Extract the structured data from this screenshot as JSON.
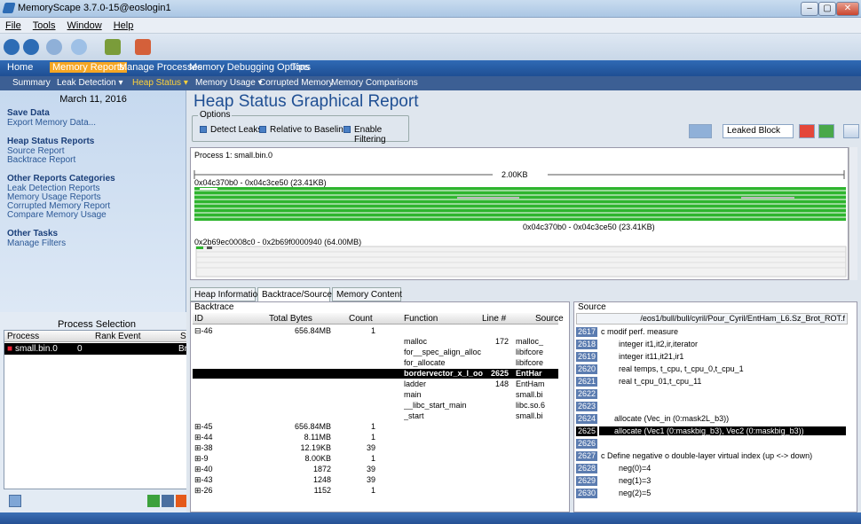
{
  "window": {
    "title": "MemoryScape 3.7.0-15@eoslogin1",
    "min": "–",
    "max": "▢",
    "close": "✕"
  },
  "menu": [
    "File",
    "Tools",
    "Window",
    "Help"
  ],
  "tabs": {
    "home": "Home",
    "memory_reports": "Memory Reports",
    "manage_processes": "Manage Processes",
    "debugging_options": "Memory Debugging Options",
    "tips": "Tips"
  },
  "subtabs": {
    "summary": "Summary",
    "leak_detection": "Leak Detection ▾",
    "heap_status": "Heap Status ▾",
    "memory_usage": "Memory Usage ▾",
    "corrupted": "Corrupted Memory",
    "comparisons": "Memory Comparisons"
  },
  "left": {
    "date": "March 11, 2016",
    "save_head": "Save Data",
    "export": "Export Memory Data...",
    "heap_head": "Heap Status Reports",
    "source_report": "Source Report",
    "backtrace_report": "Backtrace Report",
    "other_head": "Other Reports Categories",
    "leak_reports": "Leak Detection Reports",
    "usage_reports": "Memory Usage Reports",
    "corrupted_report": "Corrupted Memory Report",
    "compare_usage": "Compare Memory Usage",
    "tasks_head": "Other Tasks",
    "manage_filters": "Manage Filters"
  },
  "process_selection": {
    "title": "Process Selection",
    "headers": [
      "Process",
      "Rank",
      "Event",
      "St"
    ],
    "row": {
      "process": "small.bin.0",
      "rank": "0",
      "event": "",
      "status": "Bre"
    }
  },
  "report": {
    "title": "Heap Status Graphical Report",
    "options_label": "Options",
    "detect_leaks": "Detect Leaks",
    "relative_baseline": "Relative to Baseline",
    "enable_filtering": "Enable Filtering",
    "leaked_block": "Leaked Block"
  },
  "graph": {
    "process": "Process 1: small.bin.0",
    "scale": "2.00KB",
    "range1": "0x04c370b0 - 0x04c3ce50 (23.41KB)",
    "range1_marker": "0x04c370b0 - 0x04c3ce50 (23.41KB)",
    "range2": "0x2b69ec0008c0 - 0x2b69f0000940 (64.00MB)",
    "colors": {
      "leaked": "#2fb52f",
      "background": "#ffffff",
      "block": "#ffffff"
    }
  },
  "bottom_tabs": [
    "Heap Information",
    "Backtrace/Source",
    "Memory Content"
  ],
  "backtrace": {
    "caption": "Backtrace",
    "headers": [
      "ID",
      "Total Bytes",
      "Count",
      "Function",
      "Line #",
      "Source"
    ],
    "rows": [
      {
        "id": "⊟-46",
        "bytes": "656.84MB",
        "count": "1",
        "fn": "",
        "line": "",
        "src": ""
      },
      {
        "id": "",
        "bytes": "",
        "count": "",
        "fn": "malloc",
        "line": "172",
        "src": "malloc_"
      },
      {
        "id": "",
        "bytes": "",
        "count": "",
        "fn": "for__spec_align_alloc",
        "line": "",
        "src": "libifcore"
      },
      {
        "id": "",
        "bytes": "",
        "count": "",
        "fn": "for_allocate",
        "line": "",
        "src": "libifcore"
      },
      {
        "id": "",
        "bytes": "",
        "count": "",
        "fn": "bordervector_x_l_oo",
        "line": "2625",
        "src": "EntHar"
      },
      {
        "id": "",
        "bytes": "",
        "count": "",
        "fn": "ladder",
        "line": "148",
        "src": "EntHam"
      },
      {
        "id": "",
        "bytes": "",
        "count": "",
        "fn": "main",
        "line": "",
        "src": "small.bi"
      },
      {
        "id": "",
        "bytes": "",
        "count": "",
        "fn": "__libc_start_main",
        "line": "",
        "src": "libc.so.6"
      },
      {
        "id": "",
        "bytes": "",
        "count": "",
        "fn": "_start",
        "line": "",
        "src": "small.bi"
      },
      {
        "id": "⊞-45",
        "bytes": "656.84MB",
        "count": "1",
        "fn": "",
        "line": "",
        "src": ""
      },
      {
        "id": "⊞-44",
        "bytes": "8.11MB",
        "count": "1",
        "fn": "",
        "line": "",
        "src": ""
      },
      {
        "id": "⊞-38",
        "bytes": "12.19KB",
        "count": "39",
        "fn": "",
        "line": "",
        "src": ""
      },
      {
        "id": "⊞-9",
        "bytes": "8.00KB",
        "count": "1",
        "fn": "",
        "line": "",
        "src": ""
      },
      {
        "id": "⊞-40",
        "bytes": "1872",
        "count": "39",
        "fn": "",
        "line": "",
        "src": ""
      },
      {
        "id": "⊞-43",
        "bytes": "1248",
        "count": "39",
        "fn": "",
        "line": "",
        "src": ""
      },
      {
        "id": "⊞-26",
        "bytes": "1152",
        "count": "1",
        "fn": "",
        "line": "",
        "src": ""
      }
    ]
  },
  "source": {
    "caption": "Source",
    "path": "/eos1/bull/bull/cyril/Pour_Cyril/EntHam_L6.Sz_Brot_ROT.f",
    "lines": [
      {
        "n": "2617",
        "code": "c modif perf. measure"
      },
      {
        "n": "2618",
        "code": "        integer it1,it2,ir,iterator"
      },
      {
        "n": "2619",
        "code": "        integer it11,it21,ir1"
      },
      {
        "n": "2620",
        "code": "        real temps, t_cpu, t_cpu_0,t_cpu_1"
      },
      {
        "n": "2621",
        "code": "        real t_cpu_01,t_cpu_11"
      },
      {
        "n": "2622",
        "code": ""
      },
      {
        "n": "2623",
        "code": ""
      },
      {
        "n": "2624",
        "code": "      allocate (Vec_in (0:mask2L_b3))"
      },
      {
        "n": "2625",
        "code": "      allocate (Vec1 (0:maskbig_b3), Vec2 (0:maskbig_b3))"
      },
      {
        "n": "2626",
        "code": ""
      },
      {
        "n": "2627",
        "code": "c Define negative o double-layer virtual index (up <-> down)"
      },
      {
        "n": "2628",
        "code": "        neg(0)=4"
      },
      {
        "n": "2629",
        "code": "        neg(1)=3"
      },
      {
        "n": "2630",
        "code": "        neg(2)=5"
      }
    ]
  }
}
